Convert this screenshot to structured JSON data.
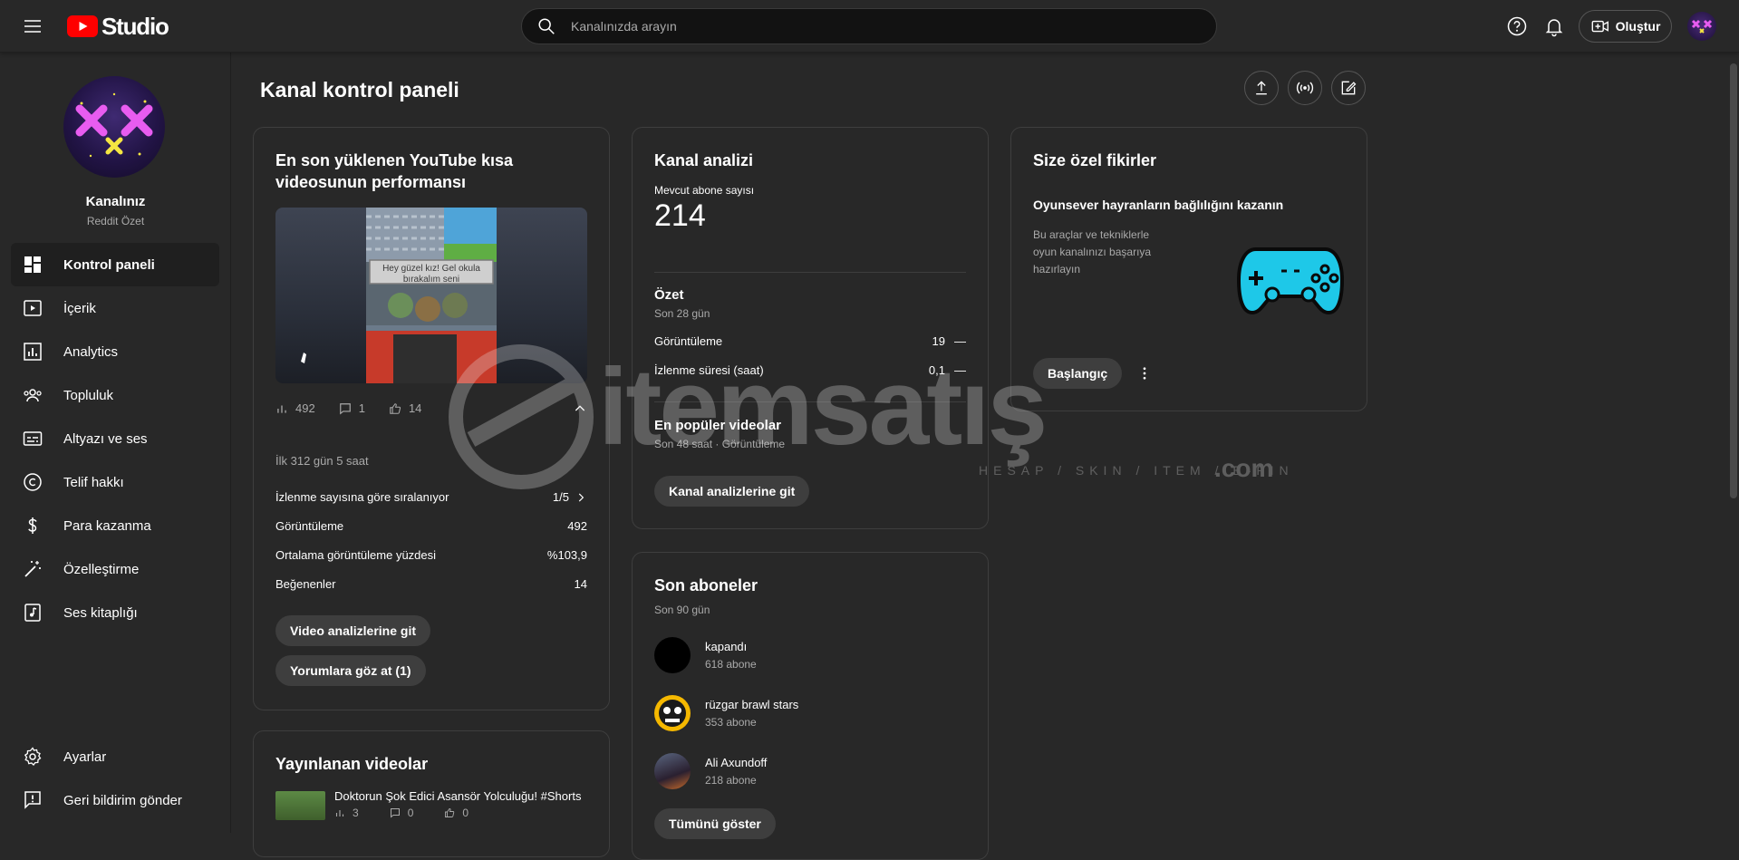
{
  "header": {
    "logo_text": "Studio",
    "search_placeholder": "Kanalınızda arayın",
    "create_label": "Oluştur"
  },
  "sidebar": {
    "channel_name": "Kanalınız",
    "channel_sub": "Reddit Özet",
    "items": [
      {
        "label": "Kontrol paneli",
        "icon": "dashboard-icon"
      },
      {
        "label": "İçerik",
        "icon": "content-icon"
      },
      {
        "label": "Analytics",
        "icon": "analytics-icon"
      },
      {
        "label": "Topluluk",
        "icon": "community-icon"
      },
      {
        "label": "Altyazı ve ses",
        "icon": "subtitles-icon"
      },
      {
        "label": "Telif hakkı",
        "icon": "copyright-icon"
      },
      {
        "label": "Para kazanma",
        "icon": "dollar-icon"
      },
      {
        "label": "Özelleştirme",
        "icon": "magic-wand-icon"
      },
      {
        "label": "Ses kitaplığı",
        "icon": "audio-library-icon"
      }
    ],
    "bottom": [
      {
        "label": "Ayarlar",
        "icon": "gear-icon"
      },
      {
        "label": "Geri bildirim gönder",
        "icon": "feedback-icon"
      }
    ]
  },
  "main": {
    "page_title": "Kanal kontrol paneli"
  },
  "latest_short": {
    "title": "En son yüklenen YouTube kısa videosunun performansı",
    "thumb_caption": "Hey güzel kız! Gel okula bırakalım seni",
    "views": "492",
    "comments": "1",
    "likes": "14",
    "period": "İlk 312 gün 5 saat",
    "rows": [
      {
        "label": "İzlenme sayısına göre sıralanıyor",
        "value": "1/5"
      },
      {
        "label": "Görüntüleme",
        "value": "492"
      },
      {
        "label": "Ortalama görüntüleme yüzdesi",
        "value": "%103,9"
      },
      {
        "label": "Beğenenler",
        "value": "14"
      }
    ],
    "btn_analytics": "Video analizlerine git",
    "btn_comments": "Yorumlara göz at (1)"
  },
  "published": {
    "title": "Yayınlanan videolar",
    "video_title": "Doktorun Şok Edici Asansör Yolculuğu! #Shorts",
    "views": "3",
    "comments": "0",
    "likes": "0"
  },
  "analytics": {
    "title": "Kanal analizi",
    "subs_label": "Mevcut abone sayısı",
    "subs_value": "214",
    "summary_title": "Özet",
    "summary_period": "Son 28 gün",
    "rows": [
      {
        "label": "Görüntüleme",
        "value": "19",
        "trend": "—"
      },
      {
        "label": "İzlenme süresi (saat)",
        "value": "0,1",
        "trend": "—"
      }
    ],
    "popular_title": "En popüler videolar",
    "popular_sub": "Son 48 saat · Görüntüleme",
    "btn": "Kanal analizlerine git"
  },
  "subscribers": {
    "title": "Son aboneler",
    "period": "Son 90 gün",
    "items": [
      {
        "name": "kapandı",
        "count": "618 abone"
      },
      {
        "name": "rüzgar brawl stars",
        "count": "353 abone"
      },
      {
        "name": "Ali Axundoff",
        "count": "218 abone"
      }
    ],
    "btn": "Tümünü göster"
  },
  "ideas": {
    "title": "Size özel fikirler",
    "subtitle": "Oyunsever hayranların bağlılığını kazanın",
    "desc": "Bu araçlar ve tekniklerle oyun kanalınızı başarıya hazırlayın",
    "btn": "Başlangıç"
  },
  "watermark": {
    "brand": "itemsatış",
    "tagline": "HESAP / SKIN / ITEM / E-PIN",
    "suffix": ".com"
  },
  "colors": {
    "background": "#282828",
    "youtube_red": "#FF0000",
    "gamepad": "#1EC8E8",
    "avatar_pink": "#E85CF0",
    "avatar_yellow": "#F5E642"
  }
}
